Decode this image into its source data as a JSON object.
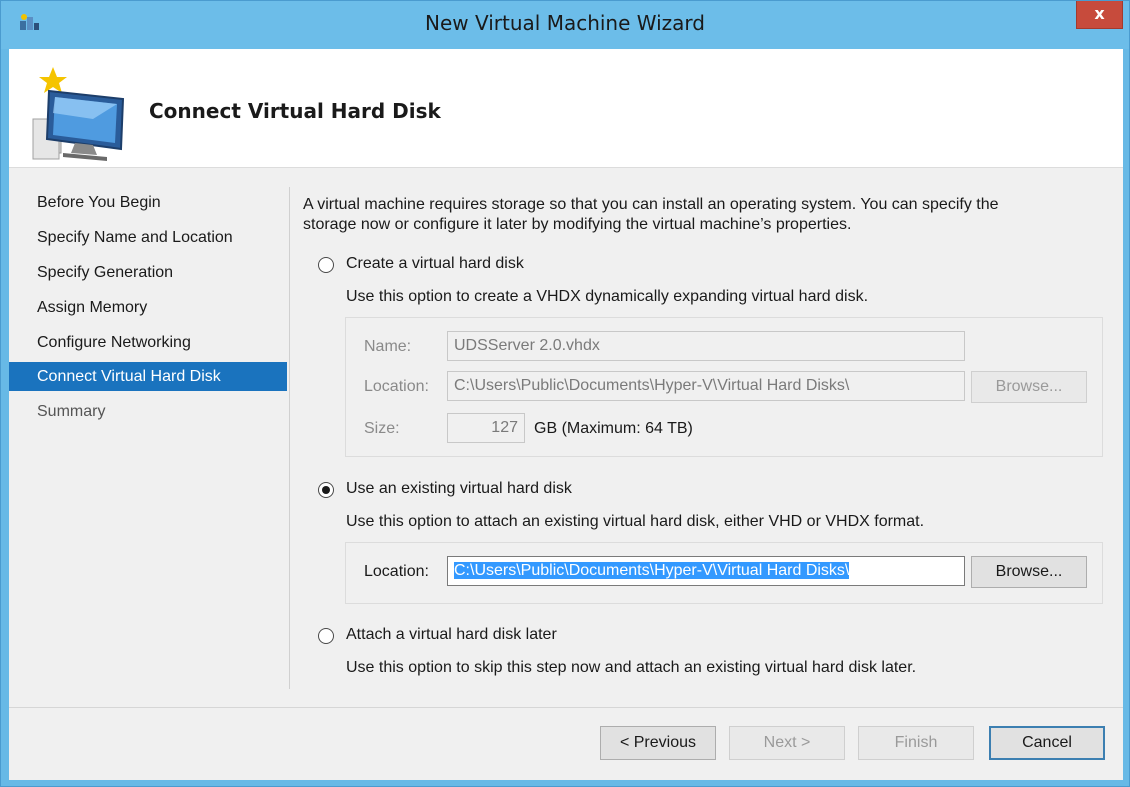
{
  "window": {
    "title": "New Virtual Machine Wizard",
    "close_label": "x"
  },
  "header": {
    "title": "Connect Virtual Hard Disk"
  },
  "nav": {
    "items": [
      {
        "label": "Before You Begin"
      },
      {
        "label": "Specify Name and Location"
      },
      {
        "label": "Specify Generation"
      },
      {
        "label": "Assign Memory"
      },
      {
        "label": "Configure Networking"
      },
      {
        "label": "Connect Virtual Hard Disk"
      },
      {
        "label": "Summary"
      }
    ],
    "active_index": 5
  },
  "main": {
    "intro_line1": "A virtual machine requires storage so that you can install an operating system. You can specify the",
    "intro_line2": "storage now or configure it later by modifying the virtual machine’s properties.",
    "option_create": {
      "label": "Create a virtual hard disk",
      "description": "Use this option to create a VHDX dynamically expanding virtual hard disk.",
      "selected": false,
      "name_label": "Name:",
      "name_value": "UDSServer 2.0.vhdx",
      "location_label": "Location:",
      "location_value": "C:\\Users\\Public\\Documents\\Hyper-V\\Virtual Hard Disks\\",
      "browse_label": "Browse...",
      "size_label": "Size:",
      "size_value": "127",
      "size_unit": "GB (Maximum: 64 TB)"
    },
    "option_existing": {
      "label": "Use an existing virtual hard disk",
      "description": "Use this option to attach an existing virtual hard disk, either VHD or VHDX format.",
      "selected": true,
      "location_label": "Location:",
      "location_value": "C:\\Users\\Public\\Documents\\Hyper-V\\Virtual Hard Disks\\",
      "browse_label": "Browse..."
    },
    "option_later": {
      "label": "Attach a virtual hard disk later",
      "description": "Use this option to skip this step now and attach an existing virtual hard disk later.",
      "selected": false
    }
  },
  "footer": {
    "previous_label": "< Previous",
    "next_label": "Next >",
    "finish_label": "Finish",
    "cancel_label": "Cancel"
  },
  "colors": {
    "titlebar": "#6cbde9",
    "nav_active": "#1a73be",
    "selection": "#3399ff",
    "close": "#c74b3c"
  }
}
